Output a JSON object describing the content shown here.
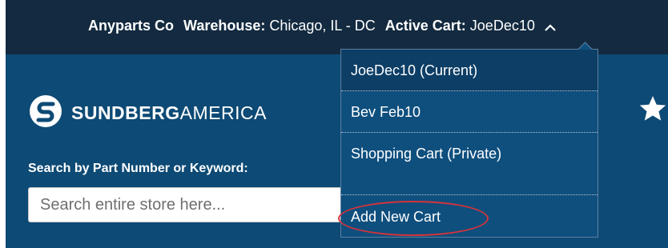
{
  "header": {
    "company": "Anyparts Co",
    "warehouse_label": "Warehouse:",
    "warehouse_value": "Chicago, IL - DC",
    "cart_label": "Active Cart:",
    "cart_value": "JoeDec10",
    "cart_toggle_icon": "chevron-up-icon"
  },
  "logo": {
    "icon": "sundberg-s-logo-icon",
    "text_bold": "SUNDBERG",
    "text_light": "AMERICA"
  },
  "search": {
    "label": "Search by Part Number or Keyword:",
    "placeholder": "Search entire store here...",
    "value": ""
  },
  "favorites_icon": "star-icon",
  "cart_dropdown": {
    "items": [
      {
        "label": "JoeDec10 (Current)"
      },
      {
        "label": "Bev Feb10"
      },
      {
        "label": "Shopping Cart (Private)"
      }
    ],
    "add_label": "Add New Cart"
  },
  "colors": {
    "topbar": "#132a40",
    "main_bg": "#0d4a75",
    "dropdown_bg": "#0f4f7e",
    "highlight_circle": "#d6333a"
  }
}
